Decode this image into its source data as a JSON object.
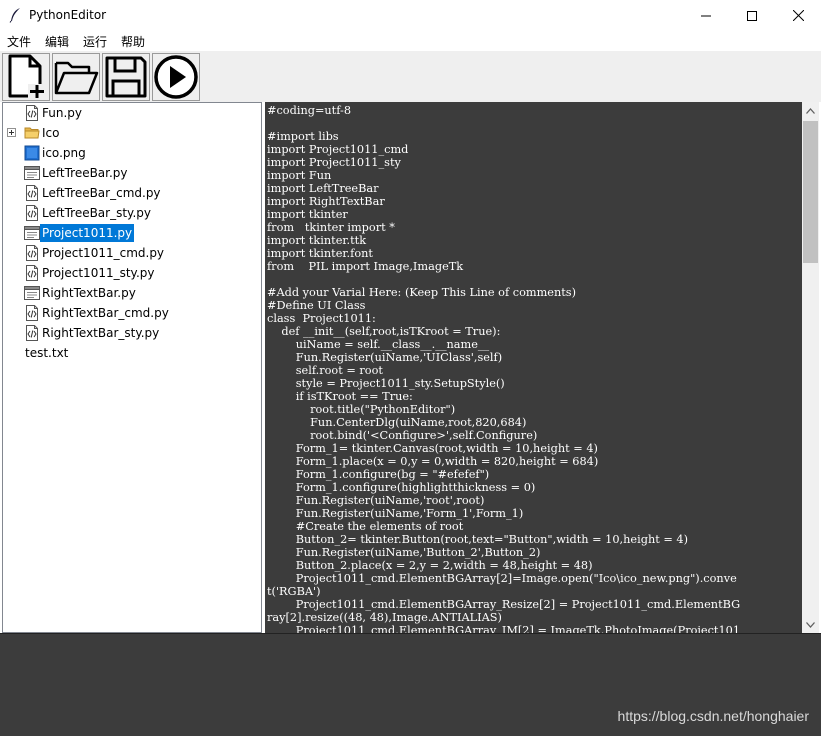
{
  "window": {
    "title": "PythonEditor",
    "controls": {
      "minimize": "minimize-icon",
      "maximize": "maximize-icon",
      "close": "close-icon"
    }
  },
  "menu": {
    "items": [
      "文件",
      "编辑",
      "运行",
      "帮助"
    ]
  },
  "toolbar": {
    "buttons": [
      {
        "icon": "new-file-icon"
      },
      {
        "icon": "open-folder-icon"
      },
      {
        "icon": "save-icon"
      },
      {
        "icon": "run-icon"
      }
    ]
  },
  "tree": {
    "items": [
      {
        "label": "Fun.py",
        "icon": "python-file-icon",
        "selected": false,
        "expandable": false
      },
      {
        "label": "Ico",
        "icon": "folder-icon",
        "selected": false,
        "expandable": true
      },
      {
        "label": "ico.png",
        "icon": "image-file-icon",
        "selected": false,
        "expandable": false
      },
      {
        "label": "LeftTreeBar.py",
        "icon": "form-file-icon",
        "selected": false,
        "expandable": false
      },
      {
        "label": "LeftTreeBar_cmd.py",
        "icon": "python-file-icon",
        "selected": false,
        "expandable": false
      },
      {
        "label": "LeftTreeBar_sty.py",
        "icon": "python-file-icon",
        "selected": false,
        "expandable": false
      },
      {
        "label": "Project1011.py",
        "icon": "form-file-icon",
        "selected": true,
        "expandable": false
      },
      {
        "label": "Project1011_cmd.py",
        "icon": "python-file-icon",
        "selected": false,
        "expandable": false
      },
      {
        "label": "Project1011_sty.py",
        "icon": "python-file-icon",
        "selected": false,
        "expandable": false
      },
      {
        "label": "RightTextBar.py",
        "icon": "form-file-icon",
        "selected": false,
        "expandable": false
      },
      {
        "label": "RightTextBar_cmd.py",
        "icon": "python-file-icon",
        "selected": false,
        "expandable": false
      },
      {
        "label": "RightTextBar_sty.py",
        "icon": "python-file-icon",
        "selected": false,
        "expandable": false
      },
      {
        "label": "test.txt",
        "icon": "",
        "selected": false,
        "expandable": false
      }
    ]
  },
  "editor": {
    "lines": [
      "#coding=utf-8",
      "",
      "#import libs",
      "import Project1011_cmd",
      "import Project1011_sty",
      "import Fun",
      "import LeftTreeBar",
      "import RightTextBar",
      "import tkinter",
      "from   tkinter import *",
      "import tkinter.ttk",
      "import tkinter.font",
      "from    PIL import Image,ImageTk",
      "",
      "#Add your Varial Here: (Keep This Line of comments)",
      "#Define UI Class",
      "class  Project1011:",
      "    def __init__(self,root,isTKroot = True):",
      "        uiName = self.__class__.__name__",
      "        Fun.Register(uiName,'UIClass',self)",
      "        self.root = root",
      "        style = Project1011_sty.SetupStyle()",
      "        if isTKroot == True:",
      "            root.title(\"PythonEditor\")",
      "            Fun.CenterDlg(uiName,root,820,684)",
      "            root.bind('<Configure>',self.Configure)",
      "        Form_1= tkinter.Canvas(root,width = 10,height = 4)",
      "        Form_1.place(x = 0,y = 0,width = 820,height = 684)",
      "        Form_1.configure(bg = \"#efefef\")",
      "        Form_1.configure(highlightthickness = 0)",
      "        Fun.Register(uiName,'root',root)",
      "        Fun.Register(uiName,'Form_1',Form_1)",
      "        #Create the elements of root",
      "        Button_2= tkinter.Button(root,text=\"Button\",width = 10,height = 4)",
      "        Fun.Register(uiName,'Button_2',Button_2)",
      "        Button_2.place(x = 2,y = 2,width = 48,height = 48)",
      "        Project1011_cmd.ElementBGArray[2]=Image.open(\"Ico\\ico_new.png\").conve",
      "t('RGBA')",
      "        Project1011_cmd.ElementBGArray_Resize[2] = Project1011_cmd.ElementBG",
      "ray[2].resize((48, 48),Image.ANTIALIAS)",
      "        Project1011_cmd.ElementBGArray_IM[2] = ImageTk.PhotoImage(Project101"
    ]
  },
  "watermark": "https://blog.csdn.net/honghaier",
  "colors": {
    "editor_bg": "#3c3c3c",
    "selection": "#0078d7",
    "toolbar_bg": "#efefef"
  }
}
